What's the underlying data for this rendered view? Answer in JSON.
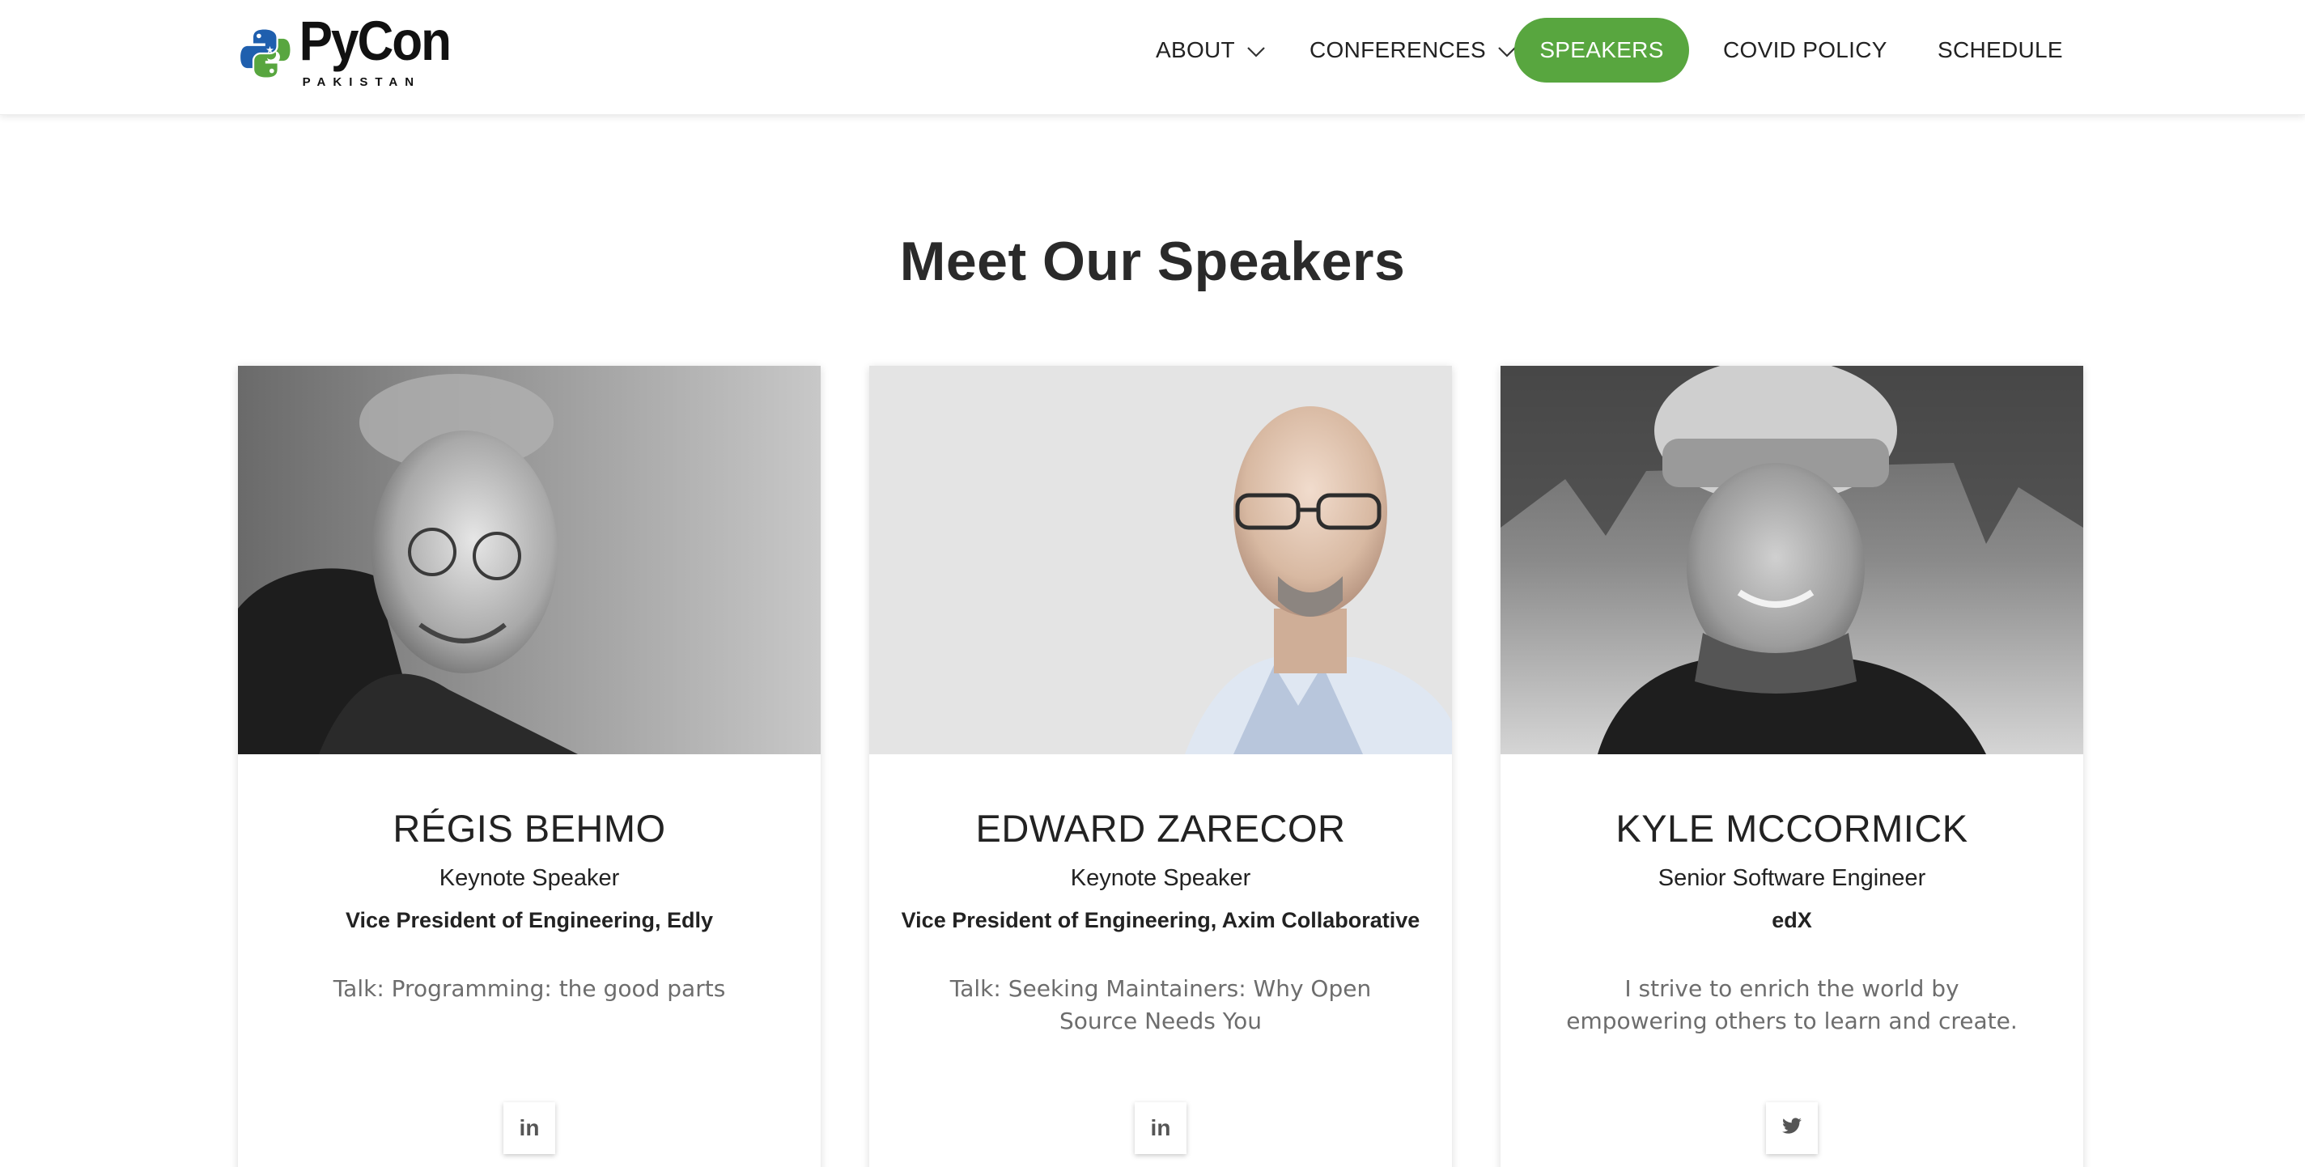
{
  "brand": {
    "name": "PyCon",
    "subtitle": "PAKISTAN"
  },
  "nav": {
    "items": [
      {
        "label": "ABOUT",
        "has_dropdown": true
      },
      {
        "label": "CONFERENCES",
        "has_dropdown": true
      },
      {
        "label": "SPEAKERS",
        "active": true
      },
      {
        "label": "COVID POLICY"
      },
      {
        "label": "SCHEDULE"
      }
    ]
  },
  "section": {
    "title": "Meet Our Speakers"
  },
  "speakers": [
    {
      "name": "RÉGIS BEHMO",
      "role": "Keynote Speaker",
      "org": "Vice President of Engineering, Edly",
      "talk": "Talk: Programming: the good parts",
      "social": "linkedin-icon",
      "social_glyph": "in"
    },
    {
      "name": "EDWARD ZARECOR",
      "role": "Keynote Speaker",
      "org": "Vice President of Engineering, Axim Collaborative",
      "talk": "Talk: Seeking Maintainers: Why Open Source Needs You",
      "social": "linkedin-icon",
      "social_glyph": "in"
    },
    {
      "name": "KYLE MCCORMICK",
      "role": "Senior Software Engineer",
      "org": "edX",
      "talk": "I strive to enrich the world by empowering others to learn and create.",
      "social": "twitter-icon",
      "social_glyph": ""
    }
  ],
  "colors": {
    "accent": "#58a63f",
    "python_blue": "#1f5fae",
    "python_green": "#58a63f",
    "text": "#222222",
    "muted": "#6d6d6d"
  }
}
